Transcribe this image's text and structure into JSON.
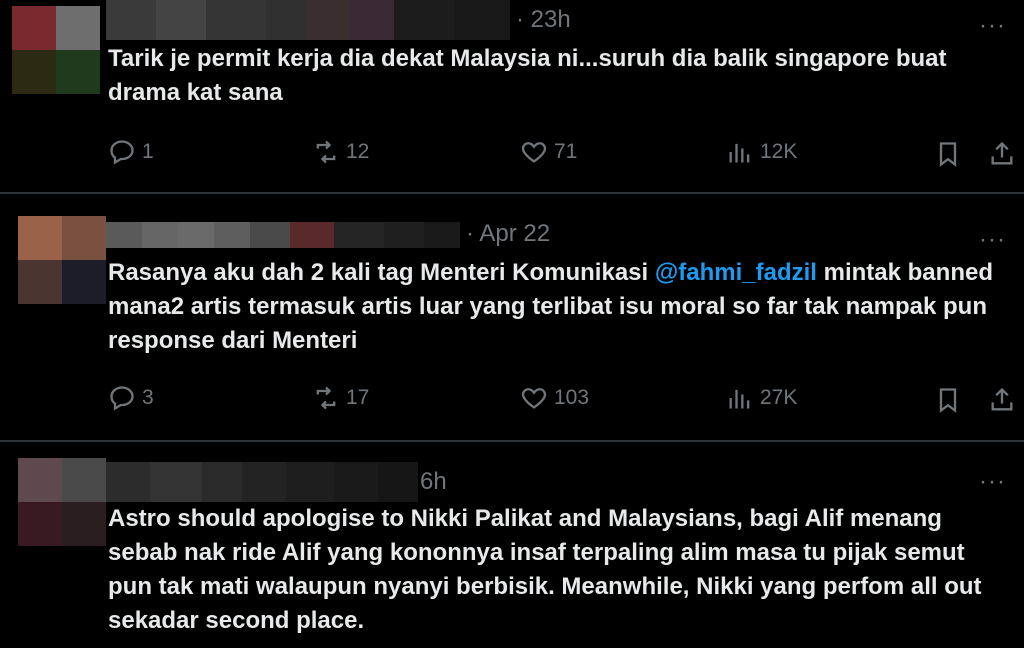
{
  "tweets": [
    {
      "time": "· 23h",
      "more": "···",
      "text": "Tarik je permit kerja dia dekat Malaysia ni...suruh dia balik singapore buat drama kat sana",
      "replies": "1",
      "retweets": "12",
      "likes": "71",
      "views": "12K",
      "avatar_colors": [
        "#7a2a2e",
        "#6e6e6e",
        "#2d2a14",
        "#1f3a1d"
      ]
    },
    {
      "time": "· Apr 22",
      "more": "···",
      "text_before": "Rasanya aku dah 2 kali tag Menteri Komunikasi ",
      "mention": "@fahmi_fadzil",
      "text_after": " mintak banned mana2 artis termasuk artis luar yang terlibat isu moral so far tak nampak pun response dari Menteri",
      "replies": "3",
      "retweets": "17",
      "likes": "103",
      "views": "27K",
      "avatar_colors": [
        "#9a6248",
        "#7a5040",
        "#4a3530",
        "#1d1d2a"
      ]
    },
    {
      "time": "6h",
      "more": "···",
      "text": "Astro should apologise to Nikki Palikat and Malaysians,  bagi Alif menang sebab nak ride Alif yang kononnya insaf terpaling alim masa tu pijak semut pun tak mati walaupun nyanyi berbisik. Meanwhile, Nikki yang perfom all out sekadar second place.",
      "avatar_colors": [
        "#5e4a4e",
        "#4a4a4a",
        "#3a1a22",
        "#2a1e20"
      ]
    }
  ],
  "icons": {
    "reply": "reply-icon",
    "retweet": "retweet-icon",
    "like": "heart-icon",
    "views": "views-icon",
    "bookmark": "bookmark-icon",
    "share": "share-icon"
  }
}
